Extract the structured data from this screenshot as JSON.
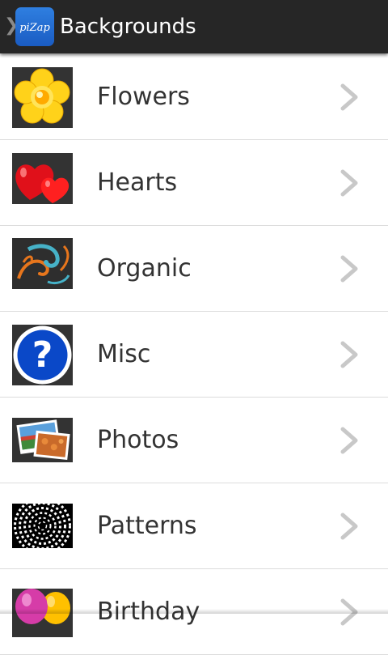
{
  "actionbar": {
    "title": "Backgrounds",
    "logo_text": "piZap",
    "background": "#262626"
  },
  "categories": [
    {
      "label": "Flowers",
      "icon": "flower-thumbnail"
    },
    {
      "label": "Hearts",
      "icon": "hearts-thumbnail"
    },
    {
      "label": "Organic",
      "icon": "swirl-thumbnail"
    },
    {
      "label": "Misc",
      "icon": "question-mark-thumbnail"
    },
    {
      "label": "Photos",
      "icon": "photos-thumbnail"
    },
    {
      "label": "Patterns",
      "icon": "pattern-thumbnail"
    },
    {
      "label": "Birthday",
      "icon": "balloons-thumbnail"
    }
  ],
  "colors": {
    "text": "#333333",
    "divider": "#dcdcdc",
    "chevron": "#c8c8c8",
    "logo_blue": "#1a5cc3"
  }
}
